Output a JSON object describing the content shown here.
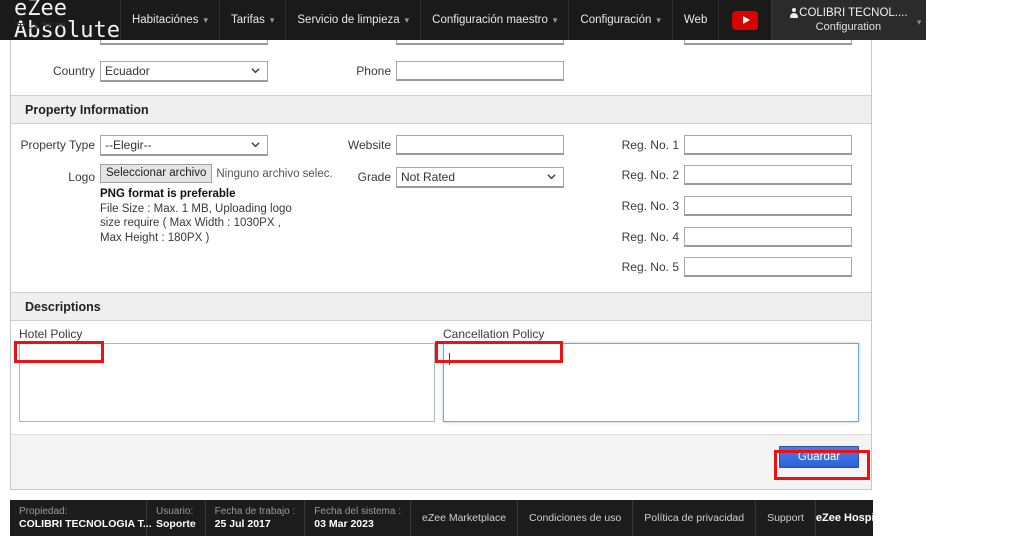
{
  "topnav": {
    "brand": "eZee Absolute",
    "items": [
      {
        "label": "Habitaciónes",
        "caret": true
      },
      {
        "label": "Tarifas",
        "caret": true
      },
      {
        "label": "Servicio de limpieza",
        "caret": true
      },
      {
        "label": "Configuración maestro",
        "caret": true
      },
      {
        "label": "Configuración",
        "caret": true
      },
      {
        "label": "Web",
        "caret": false
      }
    ],
    "youtube_icon": "youtube-icon",
    "user": {
      "name": "COLIBRI TECNOL....",
      "subtitle": "Configuration"
    }
  },
  "form": {
    "address_row": {
      "country_label": "Country",
      "country_value": "Ecuador",
      "phone_label": "Phone",
      "phone_value": ""
    },
    "property_section": {
      "title": "Property Information",
      "property_type_label": "Property Type",
      "property_type_value": "--Elegir--",
      "logo_label": "Logo",
      "logo_button": "Seleccionar archivo",
      "logo_status": "Ninguno archivo selec.",
      "hint_title": "PNG format is preferable",
      "hint_line1": "File Size : Max. 1 MB, Uploading logo",
      "hint_line2": "size require ( Max Width : 1030PX ,",
      "hint_line3": "Max Height : 180PX )",
      "website_label": "Website",
      "website_value": "",
      "grade_label": "Grade",
      "grade_value": "Not Rated",
      "reg_labels": [
        "Reg. No. 1",
        "Reg. No. 2",
        "Reg. No. 3",
        "Reg. No. 4",
        "Reg. No. 5"
      ],
      "reg_values": [
        "",
        "",
        "",
        "",
        ""
      ]
    },
    "descriptions_section": {
      "title": "Descriptions",
      "hotel_policy_label": "Hotel Policy",
      "hotel_policy_value": "",
      "cancellation_policy_label": "Cancellation Policy",
      "cancellation_policy_value": ""
    },
    "save_button": "Guardar"
  },
  "statusbar": {
    "property_caption": "Propiedad:",
    "property_value": "COLIBRI TECNOLOGIA T...",
    "user_caption": "Usuario:",
    "user_value": "Soporte",
    "workdate_caption": "Fecha de trabajo :",
    "workdate_value": "25 Jul 2017",
    "sysdate_caption": "Fecha del sistema :",
    "sysdate_value": "03 Mar 2023",
    "links": [
      "eZee Marketplace",
      "Condiciones de uso",
      "Política de privacidad",
      "Support"
    ],
    "brand": "eZee Hospitality Solution"
  },
  "colors": {
    "nav_bg": "#1a1a1a",
    "accent_button": "#2f62d6",
    "highlight": "#ee1111",
    "youtube_red": "#d90000"
  }
}
